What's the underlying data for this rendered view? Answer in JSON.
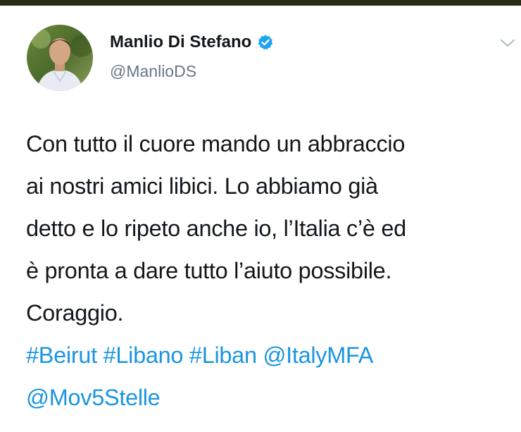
{
  "tweet": {
    "author": {
      "display_name": "Manlio Di Stefano",
      "handle": "@ManlioDS",
      "verified": true,
      "avatar_icon": "profile-photo"
    },
    "menu_icon": "chevron-down-icon",
    "text_lines": [
      "Con tutto il cuore mando un abbraccio",
      "ai nostri amici libici. Lo abbiamo già",
      "detto e lo ripeto anche io, l’Italia c’è ed",
      "è pronta a dare tutto l’aiuto possibile.",
      "Coraggio."
    ],
    "hashtags": [
      "#Beirut",
      "#Libano",
      "#Liban"
    ],
    "mentions": [
      "@ItalyMFA",
      "@Mov5Stelle"
    ]
  },
  "colors": {
    "link": "#1b95e0",
    "text": "#14171a",
    "secondary": "#657786",
    "verified_badge": "#1da1f2",
    "top_strip": "#2a2d14"
  }
}
